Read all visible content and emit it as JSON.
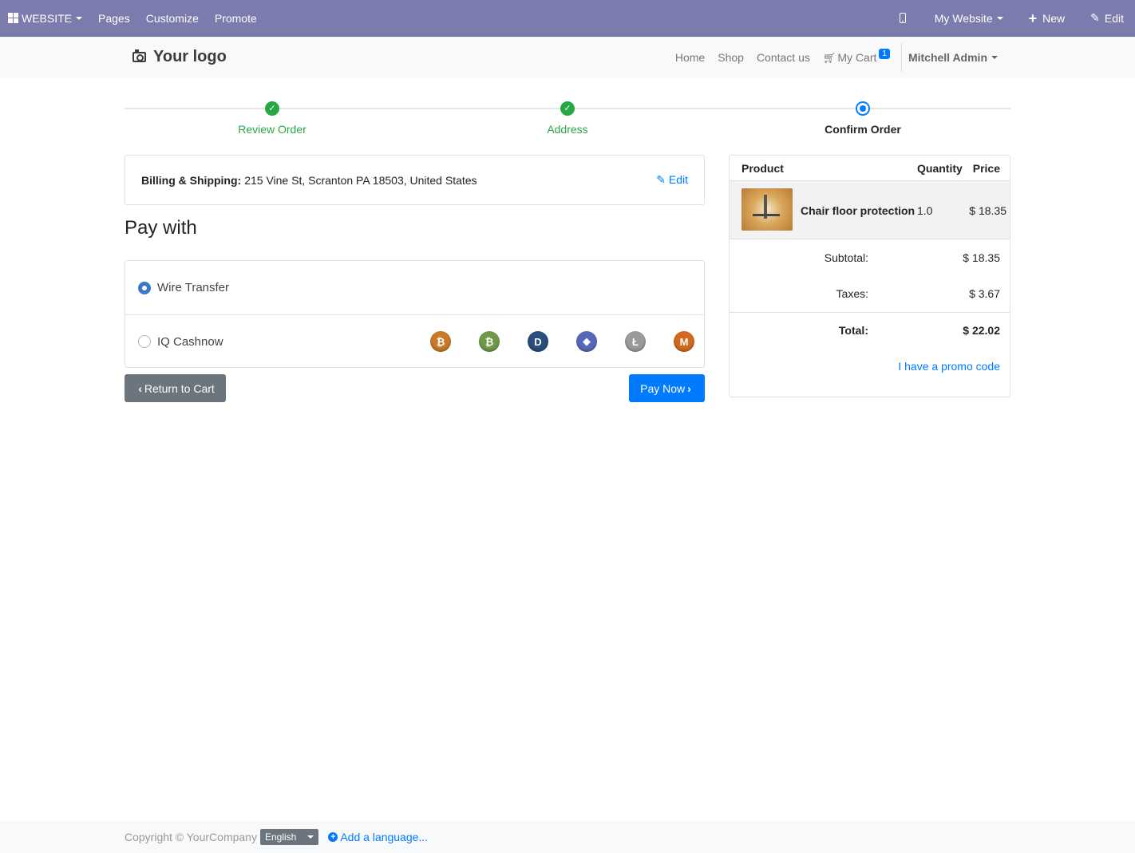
{
  "admin_bar": {
    "app_label": "WEBSITE",
    "menu": [
      "Pages",
      "Customize",
      "Promote"
    ],
    "website_selector": "My Website",
    "new_label": "New",
    "edit_label": "Edit",
    "bg_color": "#7c7bad"
  },
  "header": {
    "logo_text": "Your logo",
    "nav": [
      "Home",
      "Shop",
      "Contact us"
    ],
    "cart_label": "My Cart",
    "cart_count": "1",
    "user_name": "Mitchell Admin"
  },
  "wizard": {
    "steps": [
      {
        "label": "Review Order",
        "state": "done"
      },
      {
        "label": "Address",
        "state": "done"
      },
      {
        "label": "Confirm Order",
        "state": "active"
      }
    ]
  },
  "billing": {
    "label": "Billing & Shipping:",
    "address": "215 Vine St, Scranton PA 18503, United States",
    "edit_label": "Edit"
  },
  "payment": {
    "title": "Pay with",
    "methods": [
      {
        "label": "Wire Transfer",
        "selected": true
      },
      {
        "label": "IQ Cashnow",
        "selected": false
      }
    ],
    "coin_icons": [
      "bitcoin-icon",
      "bitcoin-cash-icon",
      "dash-icon",
      "ethereum-icon",
      "litecoin-icon",
      "monero-icon"
    ]
  },
  "buttons": {
    "return_label": "Return to Cart",
    "pay_label": "Pay Now"
  },
  "summary": {
    "headers": {
      "product": "Product",
      "quantity": "Quantity",
      "price": "Price"
    },
    "line": {
      "name": "Chair floor protection",
      "quantity": "1.0",
      "price": "$ 18.35"
    },
    "subtotal_label": "Subtotal:",
    "subtotal_value": "$ 18.35",
    "taxes_label": "Taxes:",
    "taxes_value": "$ 3.67",
    "total_label": "Total:",
    "total_value": "$ 22.02",
    "promo_label": "I have a promo code"
  },
  "footer": {
    "copyright": "Copyright © YourCompany",
    "language": "English",
    "add_language": "Add a language..."
  }
}
